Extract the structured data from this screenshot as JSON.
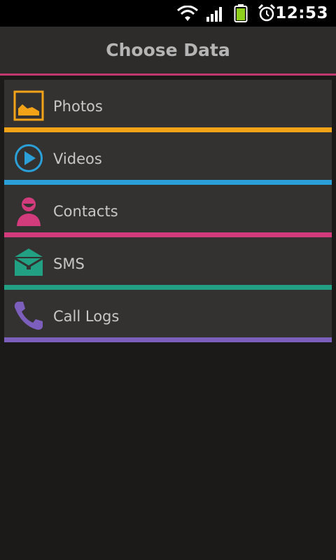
{
  "status_bar": {
    "time": "12:53",
    "icons": [
      "wifi-icon",
      "signal-icon",
      "battery-icon",
      "alarm-icon"
    ]
  },
  "header": {
    "title": "Choose Data",
    "accent_color": "#c2376e"
  },
  "items": [
    {
      "label": "Photos",
      "icon": "photo-icon",
      "color": "#f3a318"
    },
    {
      "label": "Videos",
      "icon": "play-icon",
      "color": "#2a9fd8"
    },
    {
      "label": "Contacts",
      "icon": "contact-icon",
      "color": "#d23c7c"
    },
    {
      "label": "SMS",
      "icon": "message-icon",
      "color": "#22a083"
    },
    {
      "label": "Call Logs",
      "icon": "phone-icon",
      "color": "#7c5fbd"
    }
  ]
}
